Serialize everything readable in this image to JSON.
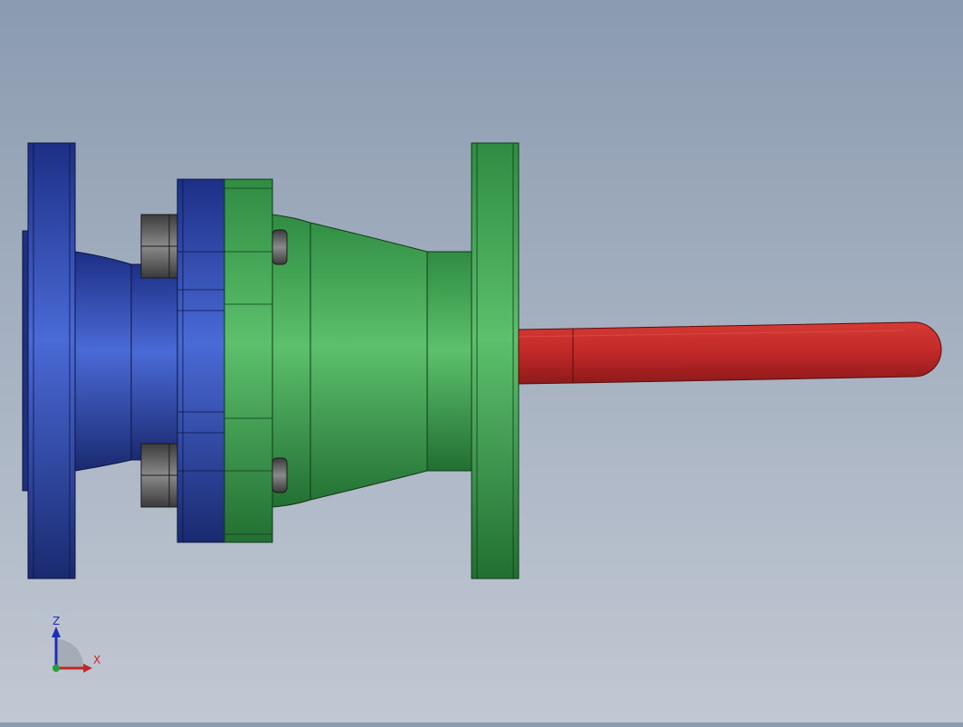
{
  "viewport": {
    "background_top": "#8b9bb0",
    "background_bottom": "#c2c8d3"
  },
  "model": {
    "parts": [
      {
        "name": "inlet-flange",
        "color": "#2c4aa8"
      },
      {
        "name": "reducer-body",
        "color": "#3a9e4f"
      },
      {
        "name": "outlet-flange",
        "color": "#3fa152"
      },
      {
        "name": "valve-handle",
        "color": "#c42a2a"
      },
      {
        "name": "hex-bolt",
        "color": "#5e5e5e"
      }
    ]
  },
  "triad": {
    "z_label": "Z",
    "x_label": "X",
    "z_color": "#1e2fb8",
    "x_color": "#c0262a",
    "y_color": "#23a03a"
  }
}
